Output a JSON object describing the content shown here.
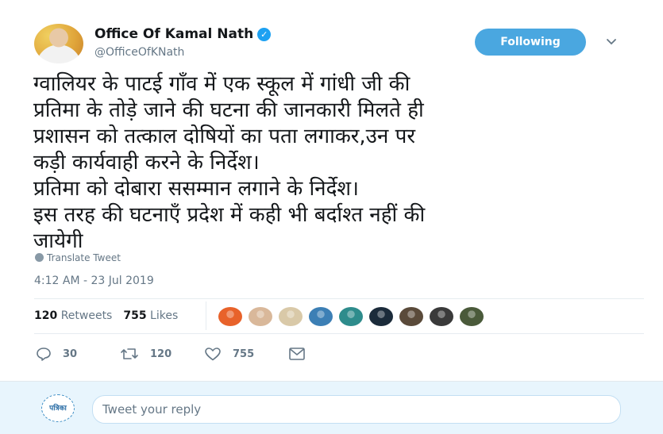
{
  "author": {
    "name": "Office Of Kamal Nath",
    "handle": "@OfficeOfKNath",
    "verified": true
  },
  "follow_button": {
    "label": "Following"
  },
  "tweet": {
    "text": "ग्वालियर के पाटई गाँव में एक स्कूल में गांधी जी की\nप्रतिमा के तोड़े जाने की घटना की जानकारी मिलते ही\nप्रशासन को तत्काल दोषियों का पता लगाकर,उन पर\nकड़ी कार्यवाही करने के निर्देश।\nप्रतिमा को दोबारा ससम्मान लगाने के निर्देश।\nइस तरह की घटनाएँ प्रदेश में कही भी बर्दाश्त नहीं की\nजायेगी",
    "translate_label": "Translate Tweet",
    "timestamp": "4:12 AM - 23 Jul 2019"
  },
  "stats": {
    "retweets_count": "120",
    "retweets_label": "Retweets",
    "likes_count": "755",
    "likes_label": "Likes"
  },
  "likers": [
    {
      "name": "liker-1",
      "color": "#e8622a"
    },
    {
      "name": "liker-2",
      "color": "#d9b89a"
    },
    {
      "name": "liker-3",
      "color": "#d9c9a8"
    },
    {
      "name": "liker-4",
      "color": "#3c7fb5"
    },
    {
      "name": "liker-5",
      "color": "#2e8c8c"
    },
    {
      "name": "liker-6",
      "color": "#1b2b3a"
    },
    {
      "name": "liker-7",
      "color": "#5a4a3a"
    },
    {
      "name": "liker-8",
      "color": "#3a3a3a"
    },
    {
      "name": "liker-9",
      "color": "#4a5a3a"
    }
  ],
  "actions": {
    "reply_count": "30",
    "retweet_count": "120",
    "like_count": "755"
  },
  "reply_box": {
    "placeholder": "Tweet your reply",
    "avatar_text": "पत्रिका"
  },
  "colors": {
    "accent": "#1da1f2",
    "following_button": "#4aa7e0",
    "secondary_text": "#657786"
  }
}
